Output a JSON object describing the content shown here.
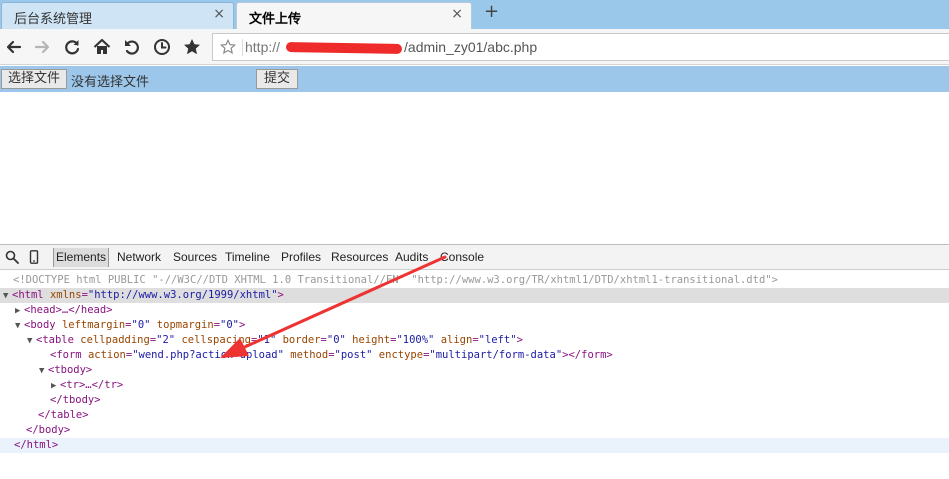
{
  "tabs": [
    {
      "title": "后台系统管理",
      "active": false
    },
    {
      "title": "文件上传",
      "active": true
    }
  ],
  "newtab_label": "+",
  "tab_close_glyph": "×",
  "address": {
    "prefix": "http://",
    "path": "/admin_zy01/abc.php"
  },
  "page": {
    "choose_file_label": "选择文件",
    "no_file_text": "没有选择文件",
    "submit_label": "提交"
  },
  "devtools": {
    "tabs": [
      "Elements",
      "Network",
      "Sources",
      "Timeline",
      "Profiles",
      "Resources",
      "Audits",
      "Console"
    ],
    "active_tab": "Elements",
    "dom": {
      "doctype": "<!DOCTYPE html PUBLIC \"-//W3C//DTD XHTML 1.0 Transitional//EN\" \"http://www.w3.org/TR/xhtml1/DTD/xhtml1-transitional.dtd\">",
      "html_open_tag": "html",
      "html_attr_name": "xmlns",
      "html_attr_value": "\"http://www.w3.org/1999/xhtml\"",
      "head_collapsed": "<head>…</head>",
      "body_tag": "body",
      "body_attr1_name": "leftmargin",
      "body_attr1_value": "\"0\"",
      "body_attr2_name": "topmargin",
      "body_attr2_value": "\"0\"",
      "table_tag": "table",
      "table_attrs": [
        {
          "name": "cellpadding",
          "value": "\"2\""
        },
        {
          "name": "cellspacing",
          "value": "\"1\""
        },
        {
          "name": "border",
          "value": "\"0\""
        },
        {
          "name": "height",
          "value": "\"100%\""
        },
        {
          "name": "align",
          "value": "\"left\""
        }
      ],
      "form_tag": "form",
      "form_attrs": [
        {
          "name": "action",
          "value": "\"wend.php?action=upload\""
        },
        {
          "name": "method",
          "value": "\"post\""
        },
        {
          "name": "enctype",
          "value": "\"multipart/form-data\""
        }
      ],
      "form_close": "</form>",
      "tbody_open": "<tbody>",
      "tr_collapsed": "<tr>…</tr>",
      "tbody_close": "</tbody>",
      "table_close": "</table>",
      "body_close": "</body>",
      "html_close": "</html>"
    }
  },
  "colors": {
    "tabstrip": "#9ac8ea",
    "formbar": "#9cc7ea",
    "redaction": "#ee2a2a",
    "arrow": "#ee3333",
    "tag": "#881280",
    "attr": "#994500",
    "value": "#1a1aa6"
  }
}
